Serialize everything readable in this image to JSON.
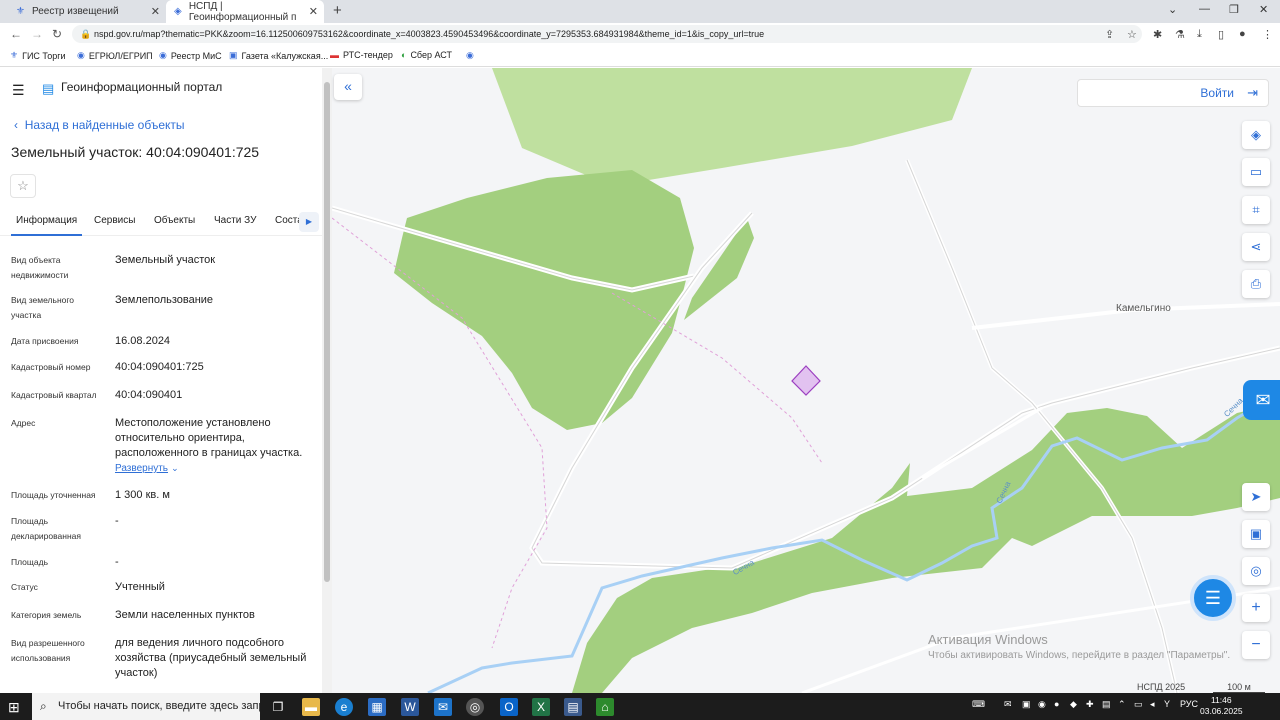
{
  "browser": {
    "tabs": [
      {
        "label": "Реестр извещений",
        "icon": "gov-emblem-icon"
      },
      {
        "label": "НСПД | Геоинформационный п",
        "icon": "nspd-icon"
      }
    ],
    "url": "nspd.gov.ru/map?thematic=PKK&zoom=16.112500609753162&coordinate_x=4003823.4590453496&coordinate_y=7295353.684931984&theme_id=1&is_copy_url=true",
    "bookmarks": [
      "ГИС Торги",
      "ЕГРЮЛ/ЕГРИП",
      "Реестр МиС",
      "Газета «Калужская...",
      "РТС-тендер",
      "Сбер АСТ"
    ]
  },
  "header": {
    "portal_title": "Геоинформационный портал"
  },
  "object": {
    "back_label": "Назад в найденные объекты",
    "title": "Земельный участок: 40:04:090401:725",
    "tabs": [
      "Информация",
      "Сервисы",
      "Объекты",
      "Части ЗУ",
      "Соста"
    ],
    "expand_label": "Развернуть",
    "fields": [
      {
        "label": "Вид объекта недвижимости",
        "value": "Земельный участок"
      },
      {
        "label": "Вид земельного участка",
        "value": "Землепользование"
      },
      {
        "label": "Дата присвоения",
        "value": "16.08.2024"
      },
      {
        "label": "Кадастровый номер",
        "value": "40:04:090401:725"
      },
      {
        "label": "Кадастровый квартал",
        "value": "40:04:090401"
      },
      {
        "label": "Адрес",
        "value": "Местоположение установлено относительно ориентира, расположенного в границах участка."
      },
      {
        "label": "Площадь уточненная",
        "value": "1 300 кв. м"
      },
      {
        "label": "Площадь декларированная",
        "value": "-"
      },
      {
        "label": "Площадь",
        "value": "-"
      },
      {
        "label": "Статус",
        "value": "Учтенный"
      },
      {
        "label": "Категория земель",
        "value": "Земли населенных пунктов"
      },
      {
        "label": "Вид разрешенного использования",
        "value": "для ведения личного подсобного хозяйства (приусадебный земельный участок)"
      }
    ]
  },
  "map": {
    "login_label": "Войти",
    "village_label": "Камельгино",
    "river_label": "Сечна",
    "activation_title": "Активация Windows",
    "activation_text": "Чтобы активировать Windows, перейдите в раздел \"Параметры\".",
    "copyright": "НСПД 2025",
    "scale": "100 м",
    "parcel_color": "#e2c2f0",
    "forest_color": "#a3cf7f"
  },
  "taskbar": {
    "search_placeholder": "Чтобы начать поиск, введите здесь запрос",
    "language": "РУС",
    "time": "11:46",
    "date": "03.06.2025"
  }
}
